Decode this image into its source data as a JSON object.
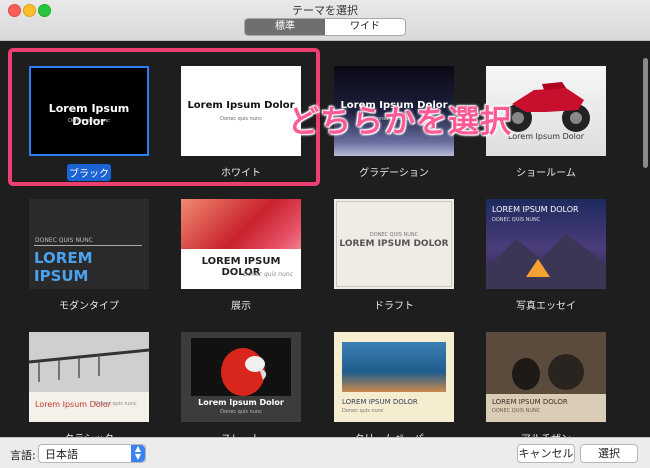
{
  "window": {
    "title": "テーマを選択"
  },
  "tabs": [
    {
      "label": "標準",
      "active": true
    },
    {
      "label": "ワイド",
      "active": false
    }
  ],
  "themes": [
    {
      "label": "ブラック",
      "thumb_title": "Lorem Ipsum Dolor",
      "thumb_sub": "Donec quis nunc",
      "selected": true
    },
    {
      "label": "ホワイト",
      "thumb_title": "Lorem Ipsum Dolor",
      "thumb_sub": "Donec quis nunc"
    },
    {
      "label": "グラデーション",
      "thumb_title": "Lorem Ipsum Dolor",
      "thumb_sub": "Donec quis nunc"
    },
    {
      "label": "ショールーム",
      "thumb_title": "Lorem Ipsum Dolor"
    },
    {
      "label": "モダンタイプ",
      "thumb_title": "LOREM IPSUM",
      "thumb_sub": "DONEC QUIS NUNC"
    },
    {
      "label": "展示",
      "thumb_title": "LOREM IPSUM DOLOR",
      "thumb_sub": "Donec quis nunc"
    },
    {
      "label": "ドラフト",
      "thumb_title": "LOREM IPSUM DOLOR",
      "thumb_sub": "DONEC QUIS NUNC"
    },
    {
      "label": "写真エッセイ",
      "thumb_title": "LOREM IPSUM DOLOR",
      "thumb_sub": "DONEC QUIS NUNC"
    },
    {
      "label": "クラシック",
      "thumb_title": "Lorem Ipsum Dolor",
      "thumb_sub": "Donec quis nunc"
    },
    {
      "label": "スレート",
      "thumb_title": "Lorem Ipsum Dolor",
      "thumb_sub": "Donec quis nunc"
    },
    {
      "label": "クリームペーパー",
      "thumb_title": "LOREM IPSUM DOLOR",
      "thumb_sub": "Donec quis nunc"
    },
    {
      "label": "アルチザン",
      "thumb_title": "LOREM IPSUM DOLOR",
      "thumb_sub": "DONEC QUIS NUNC"
    }
  ],
  "overlay_text": "どちらかを選択",
  "footer": {
    "language_label": "言語:",
    "language_value": "日本語",
    "cancel_label": "キャンセル",
    "select_label": "選択"
  },
  "colors": {
    "highlight": "#ee3f73",
    "selection": "#1a64d6"
  }
}
